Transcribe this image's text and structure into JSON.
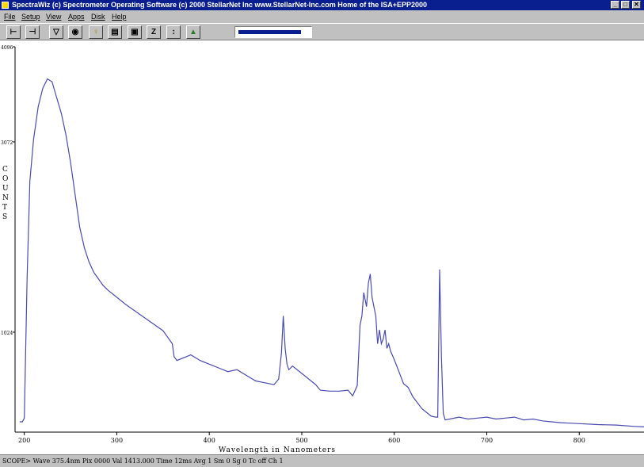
{
  "window": {
    "title": "SpectraWiz (c)  Spectrometer Operating Software (c) 2000 StellarNet Inc  www.StellarNet-Inc.com  Home of the ISA+EPP2000",
    "controls": [
      "_",
      "□",
      "✕"
    ]
  },
  "menu": [
    "File",
    "Setup",
    "View",
    "Apps",
    "Disk",
    "Help"
  ],
  "toolbar": {
    "buttons": [
      {
        "name": "bracket-left-icon",
        "glyph": "⊢"
      },
      {
        "name": "bracket-right-icon",
        "glyph": "⊣"
      },
      {
        "name": "filter-icon",
        "glyph": "▽"
      },
      {
        "name": "target-icon",
        "glyph": "◉"
      },
      {
        "name": "lightbulb-icon",
        "glyph": "♀"
      },
      {
        "name": "printer-icon",
        "glyph": "▤"
      },
      {
        "name": "save-disk-icon",
        "glyph": "▣"
      },
      {
        "name": "zoom-z-icon",
        "glyph": "Z"
      },
      {
        "name": "scale-updown-icon",
        "glyph": "↕"
      },
      {
        "name": "chart-icon",
        "glyph": "▲"
      }
    ],
    "slider_fraction": 0.9
  },
  "status": {
    "text": "SCOPE>  Wave 375.4nm  Pix 0000  Val 1413.000  Time 12ms  Avg 1  Sm 0  Sg 0  Tc off  Ch 1"
  },
  "chart_data": {
    "type": "line",
    "xlabel": "Wavelength in Nanometers",
    "ylabel": "COUNTS",
    "xlim": [
      190,
      870
    ],
    "ylim": [
      0,
      4096
    ],
    "x_ticks": [
      200,
      300,
      400,
      500,
      600,
      700,
      800
    ],
    "y_ticks": [
      1024,
      3072,
      4096
    ],
    "grid": false,
    "color": "#4a4ab0",
    "series": [
      {
        "x": [
          195,
          198,
          200,
          203,
          206,
          210,
          215,
          220,
          225,
          230,
          235,
          240,
          245,
          250,
          255,
          260,
          265,
          270,
          275,
          280,
          285,
          290,
          300,
          310,
          320,
          330,
          340,
          350,
          355,
          360,
          362,
          365,
          370,
          380,
          390,
          400,
          410,
          420,
          430,
          440,
          450,
          460,
          470,
          475,
          478,
          480,
          482,
          484,
          486,
          490,
          500,
          510,
          515,
          520,
          530,
          540,
          550,
          555,
          560,
          563,
          565,
          567,
          570,
          572,
          574,
          576,
          578,
          580,
          582,
          584,
          586,
          588,
          590,
          592,
          594,
          596,
          600,
          605,
          610,
          615,
          620,
          630,
          640,
          645,
          647,
          649,
          651,
          653,
          655,
          660,
          670,
          680,
          690,
          700,
          710,
          720,
          730,
          740,
          750,
          760,
          770,
          780,
          790,
          800,
          820,
          840,
          860,
          870
        ],
        "y": [
          60,
          60,
          100,
          1600,
          2650,
          3100,
          3450,
          3650,
          3750,
          3720,
          3550,
          3380,
          3150,
          2850,
          2500,
          2150,
          1930,
          1780,
          1670,
          1600,
          1530,
          1480,
          1400,
          1320,
          1250,
          1180,
          1110,
          1040,
          970,
          900,
          760,
          720,
          740,
          780,
          720,
          680,
          640,
          600,
          620,
          560,
          500,
          480,
          460,
          520,
          800,
          1200,
          850,
          680,
          620,
          660,
          580,
          500,
          460,
          400,
          390,
          390,
          400,
          340,
          450,
          1100,
          1200,
          1450,
          1300,
          1550,
          1650,
          1400,
          1300,
          1200,
          900,
          1050,
          900,
          950,
          1050,
          850,
          900,
          820,
          730,
          600,
          470,
          430,
          330,
          200,
          120,
          110,
          110,
          1700,
          750,
          150,
          80,
          90,
          110,
          90,
          100,
          110,
          90,
          100,
          110,
          80,
          90,
          70,
          60,
          50,
          45,
          40,
          30,
          25,
          10,
          5
        ]
      }
    ]
  }
}
